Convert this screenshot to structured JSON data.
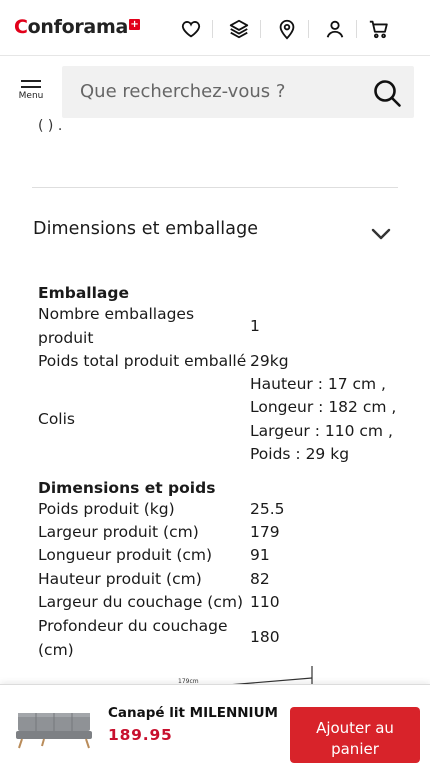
{
  "header": {
    "logo_text": "Conforama",
    "logo_first_letter": "C",
    "logo_rest": "onforama",
    "logo_cross": "+",
    "icons": [
      "heart-icon",
      "layers-icon",
      "location-pin-icon",
      "user-icon",
      "cart-icon"
    ]
  },
  "search": {
    "menu_label": "Menu",
    "placeholder": "Que recherchez-vous ?"
  },
  "partial_text": "( ) .",
  "section": {
    "title": "Dimensions et emballage"
  },
  "packaging": {
    "title": "Emballage",
    "rows": [
      {
        "label": "Nombre emballages produit",
        "value": "1"
      },
      {
        "label": "Poids total produit emballé",
        "value": "29kg"
      },
      {
        "label": "Colis",
        "value_lines": [
          "Hauteur : 17 cm ,",
          "Longeur : 182 cm ,",
          "Largeur : 110 cm ,",
          "Poids : 29 kg"
        ]
      }
    ]
  },
  "dimensions": {
    "title": "Dimensions et poids",
    "rows": [
      {
        "label": "Poids produit (kg)",
        "value": "25.5"
      },
      {
        "label": "Largeur produit (cm)",
        "value": "179"
      },
      {
        "label": "Longueur produit (cm)",
        "value": "91"
      },
      {
        "label": "Hauteur produit (cm)",
        "value": "82"
      },
      {
        "label": "Largeur du couchage (cm)",
        "value": "110"
      },
      {
        "label": "Profondeur du couchage (cm)",
        "value": "180"
      }
    ]
  },
  "drawing_label": "179cm",
  "sticky": {
    "product_name": "Canapé lit MILENNIUM",
    "price": "189.95",
    "cart_button_label": "Ajouter au panier"
  },
  "colors": {
    "brand_red": "#e2001a",
    "price_red": "#c8102e",
    "button_red": "#d8232a",
    "search_bg": "#f1f1f1"
  }
}
